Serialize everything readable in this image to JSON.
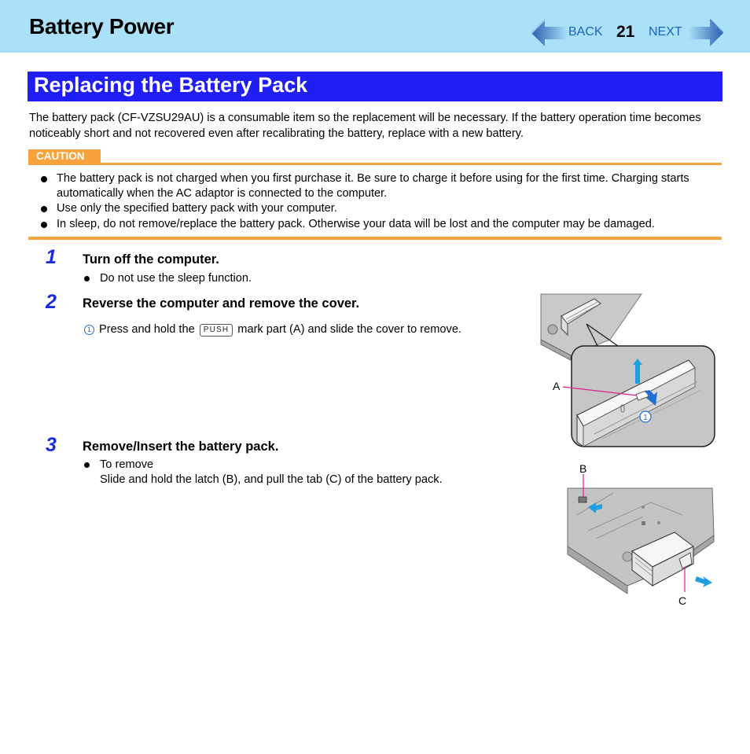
{
  "header": {
    "chapter_title": "Battery Power",
    "nav": {
      "back_label": "BACK",
      "page_number": "21",
      "next_label": "NEXT",
      "back_icon": "back-arrow-icon",
      "next_icon": "next-arrow-icon"
    }
  },
  "section": {
    "title": "Replacing the Battery Pack",
    "intro": "The battery pack (CF-VZSU29AU) is a consumable item so the replacement will be necessary. If the battery operation time becomes noticeably short and not recovered even after recalibrating the battery, replace with a new battery."
  },
  "caution": {
    "label": "CAUTION",
    "items": [
      "The battery pack is not charged when you first purchase it. Be sure to charge it before using for the first time. Charging starts automatically when the AC adaptor is connected to the computer.",
      "Use only the specified battery pack with your computer.",
      "In sleep, do not remove/replace the battery pack. Otherwise your data will be lost and the computer may be damaged."
    ]
  },
  "steps": [
    {
      "number": "1",
      "title": "Turn off the computer.",
      "bullets": [
        "Do not use the sleep function."
      ]
    },
    {
      "number": "2",
      "title": "Reverse the computer and remove the cover.",
      "substep": {
        "marker": "1",
        "text_before": "Press and hold the",
        "mark": "PUSH",
        "text_after": "mark part (A) and slide the cover to remove."
      },
      "figure": {
        "description": "Underside of computer with cover being slid off",
        "callout": "A",
        "step_marker": "1"
      }
    },
    {
      "number": "3",
      "title": "Remove/Insert the battery pack.",
      "bullet_heading": "To remove",
      "bullet_text": "Slide and hold the latch (B), and pull the tab (C) of the battery pack.",
      "figure": {
        "description": "Battery pack being pulled out from computer",
        "callouts": [
          "B",
          "C"
        ]
      }
    }
  ],
  "colors": {
    "header_bg": "#aae0f8",
    "section_title_bg": "#1e1ef5",
    "caution": "#f7a23a",
    "step_number": "#1a2adf",
    "nav_link": "#1a64b8",
    "callout_line": "#e0208c",
    "action_arrow": "#1ea0e0"
  }
}
